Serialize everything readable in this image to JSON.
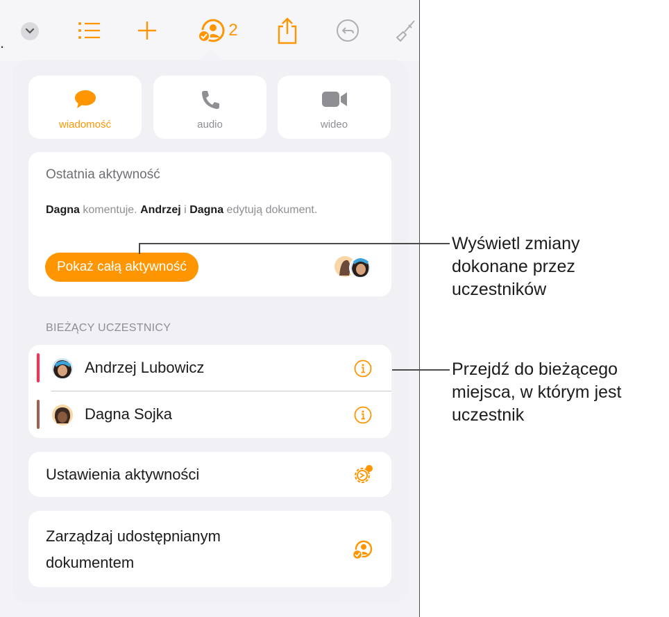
{
  "toolbar": {
    "dots": ".",
    "collab_count": "2",
    "icons": [
      "chevron-down-icon",
      "list-icon",
      "plus-icon",
      "collaboration-icon",
      "share-icon",
      "undo-icon",
      "paintbrush-icon"
    ]
  },
  "communication": {
    "message_label": "wiadomość",
    "audio_label": "audio",
    "video_label": "wideo"
  },
  "activity": {
    "title": "Ostatnia aktywność",
    "name1": "Dagna",
    "text1": " komentuje. ",
    "name2": "Andrzej",
    "text2": " i ",
    "name3": "Dagna",
    "text3": " edytują dokument.",
    "button_label": "Pokaż całą aktywność"
  },
  "participants": {
    "section_title": "BIEŻĄCY UCZESTNICY",
    "items": [
      {
        "name": "Andrzej Lubowicz",
        "color": "#ff2d55"
      },
      {
        "name": "Dagna Sojka",
        "color": "#a2614f"
      }
    ]
  },
  "settings": {
    "label": "Ustawienia aktywności"
  },
  "manage": {
    "label": "Zarządzaj udostępnianym dokumentem"
  },
  "callouts": {
    "activity": "Wyświetl zmiany dokonane przez uczestników",
    "participant": "Przejdź do bieżącego miejsca, w którym jest uczestnik"
  },
  "colors": {
    "accent": "#ff9500",
    "card": "#ffffff",
    "background": "#f2f2f7"
  }
}
